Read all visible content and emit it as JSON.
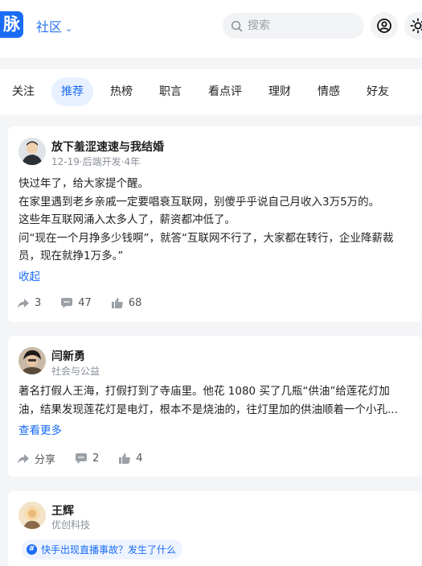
{
  "header": {
    "logo_text": "脉",
    "community_label": "社区",
    "search_placeholder": "搜索"
  },
  "tabs": [
    {
      "label": "关注",
      "active": false
    },
    {
      "label": "推荐",
      "active": true
    },
    {
      "label": "热榜",
      "active": false
    },
    {
      "label": "职言",
      "active": false
    },
    {
      "label": "看点评",
      "active": false
    },
    {
      "label": "理财",
      "active": false
    },
    {
      "label": "情感",
      "active": false
    },
    {
      "label": "好友",
      "active": false
    }
  ],
  "posts": [
    {
      "author": "放下羞涩速速与我结婚",
      "meta": "12-19·后端开发·4年",
      "lines": [
        "快过年了，给大家提个醒。",
        "在家里遇到老乡亲戚一定要唱衰互联网，别傻乎乎说自己月收入3万5万的。",
        "这些年互联网涌入太多人了，薪资都冲低了。",
        "问“现在一个月挣多少钱啊”，就答“互联网不行了，大家都在转行，企业降薪裁",
        "员，现在就挣1万多。”"
      ],
      "link": "收起",
      "share": "3",
      "comments": "47",
      "likes": "68"
    },
    {
      "author": "闫新勇",
      "meta": "社会与公益",
      "lines": [
        "著名打假人王海，打假打到了寺庙里。他花 1080 买了几瓶“供油”给莲花灯加",
        "油，结果发现莲花灯是电灯，根本不是烧油的，往灯里加的供油顺着一个小孔..."
      ],
      "link": "查看更多",
      "share": "分享",
      "comments": "2",
      "likes": "4"
    },
    {
      "author": "王辉",
      "meta": "优创科技",
      "topic": "快手出现直播事故？发生了什么"
    }
  ],
  "colors": {
    "accent": "#1a6cf5",
    "tab_active_bg": "#e8f1ff"
  },
  "icons": [
    "search-icon",
    "user-icon",
    "sun-icon",
    "share-icon",
    "comment-icon",
    "like-icon",
    "hash-icon"
  ]
}
